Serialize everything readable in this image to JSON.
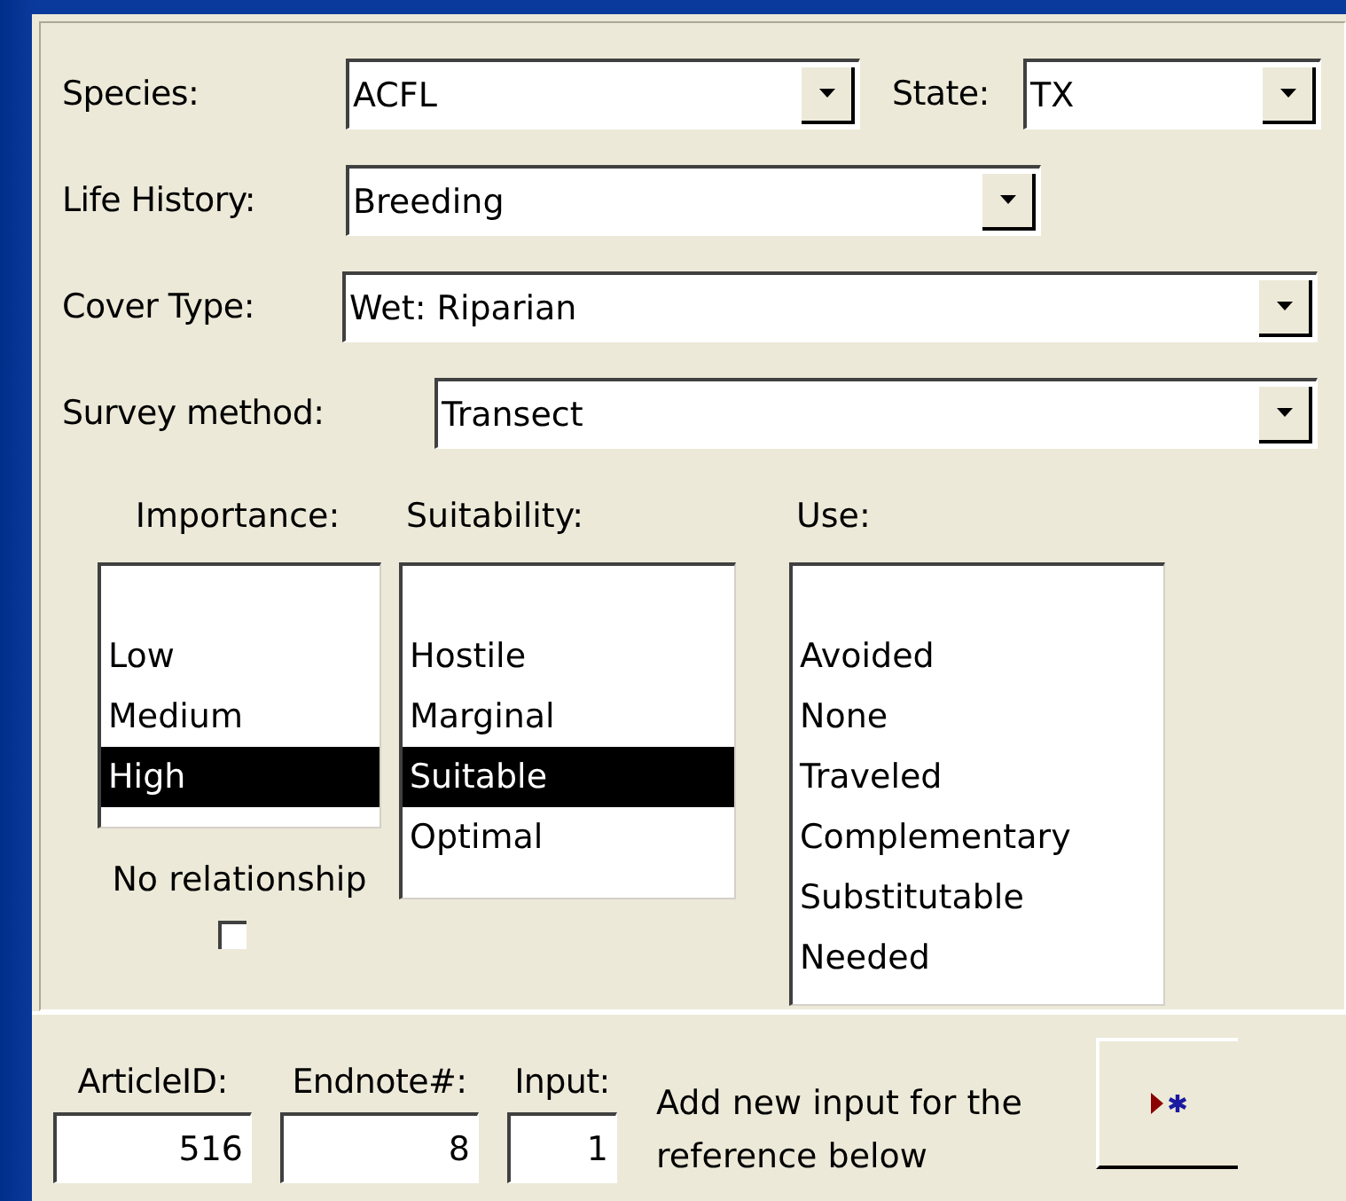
{
  "fields": [
    {
      "label": "Species:",
      "value": "ACFL",
      "kind": "species"
    },
    {
      "label": "State:",
      "value": "TX",
      "kind": "state"
    },
    {
      "label": "Life History:",
      "value": "Breeding",
      "kind": "life"
    },
    {
      "label": "Cover Type:",
      "value": "Wet: Riparian",
      "kind": "cover"
    },
    {
      "label": "Survey method:",
      "value": "Transect",
      "kind": "survey"
    }
  ],
  "lists": [
    {
      "label": "Importance:",
      "kind": "importance",
      "items": [
        {
          "label": "Low",
          "selected": false
        },
        {
          "label": "Medium",
          "selected": false
        },
        {
          "label": "High",
          "selected": true
        }
      ]
    },
    {
      "label": "Suitability:",
      "kind": "suitability",
      "items": [
        {
          "label": "Hostile",
          "selected": false
        },
        {
          "label": "Marginal",
          "selected": false
        },
        {
          "label": "Suitable",
          "selected": true
        },
        {
          "label": "Optimal",
          "selected": false
        }
      ]
    },
    {
      "label": "Use:",
      "kind": "use",
      "items": [
        {
          "label": "Avoided",
          "selected": false
        },
        {
          "label": "None",
          "selected": false
        },
        {
          "label": "Traveled",
          "selected": false
        },
        {
          "label": "Complementary",
          "selected": false
        },
        {
          "label": "Substitutable",
          "selected": false
        },
        {
          "label": "Needed",
          "selected": false
        }
      ]
    }
  ],
  "no_relationship": {
    "label": "No relationship",
    "checked": false
  },
  "footer": {
    "inputs": [
      {
        "label": "ArticleID:",
        "value": "516",
        "kind": "article"
      },
      {
        "label": "Endnote#:",
        "value": "8",
        "kind": "endnote"
      },
      {
        "label": "Input:",
        "value": "1",
        "kind": "input"
      }
    ],
    "hint": "Add new input for the reference below"
  }
}
